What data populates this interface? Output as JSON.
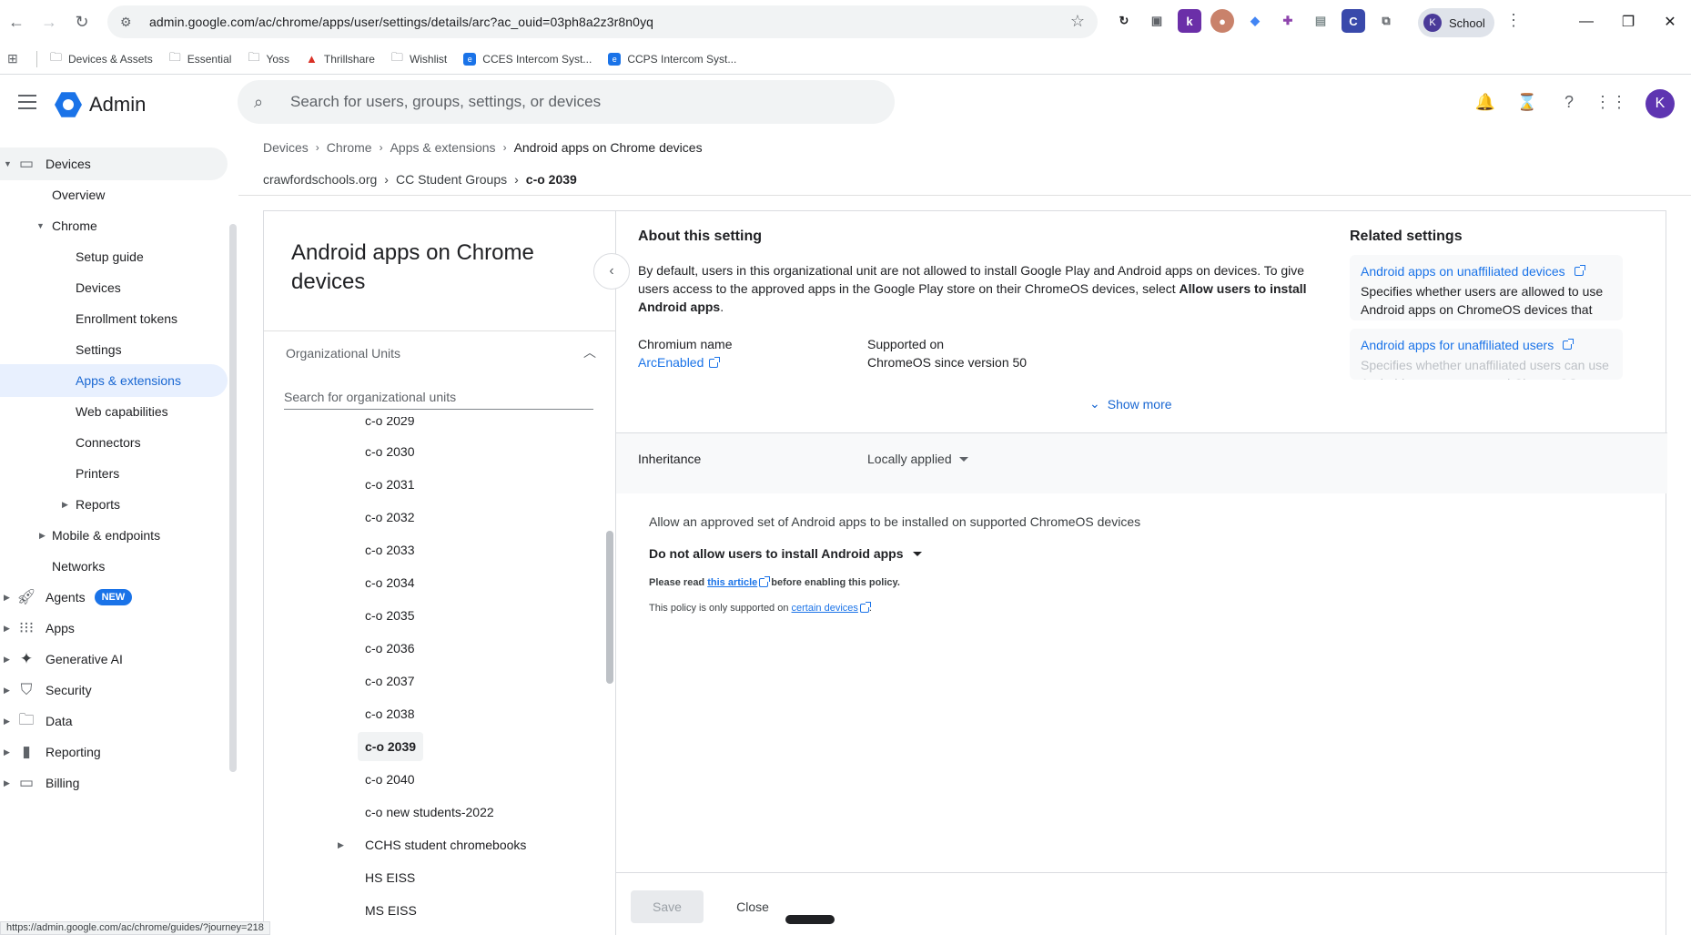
{
  "browser": {
    "url": "admin.google.com/ac/chrome/apps/user/settings/details/arc?ac_ouid=03ph8a2z3r8n0yq",
    "profile_initial": "K",
    "profile_label": "School",
    "bookmarks": [
      "Devices & Assets",
      "Essential",
      "Yoss",
      "Thrillshare",
      "Wishlist",
      "CCES Intercom Syst...",
      "CCPS Intercom Syst..."
    ],
    "status_url": "https://admin.google.com/ac/chrome/guides/?journey=218"
  },
  "header": {
    "product": "Admin",
    "search_placeholder": "Search for users, groups, settings, or devices",
    "avatar_initial": "K"
  },
  "nav": {
    "devices": "Devices",
    "overview": "Overview",
    "chrome": "Chrome",
    "setup_guide": "Setup guide",
    "chrome_devices": "Devices",
    "enrollment_tokens": "Enrollment tokens",
    "settings": "Settings",
    "apps_extensions": "Apps & extensions",
    "web_capabilities": "Web capabilities",
    "connectors": "Connectors",
    "printers": "Printers",
    "reports": "Reports",
    "mobile_endpoints": "Mobile & endpoints",
    "networks": "Networks",
    "agents": "Agents",
    "agents_badge": "NEW",
    "apps": "Apps",
    "generative_ai": "Generative AI",
    "security": "Security",
    "data": "Data",
    "reporting": "Reporting",
    "billing": "Billing"
  },
  "breadcrumb": {
    "items": [
      "Devices",
      "Chrome",
      "Apps & extensions",
      "Android apps on Chrome devices"
    ],
    "org": [
      "crawfordschools.org",
      "CC Student Groups",
      "c-o 2039"
    ]
  },
  "ou_panel": {
    "title": "Android apps on Chrome devices",
    "section": "Organizational Units",
    "search_placeholder": "Search for organizational units",
    "units": [
      "c-o 2029",
      "c-o 2030",
      "c-o 2031",
      "c-o 2032",
      "c-o 2033",
      "c-o 2034",
      "c-o 2035",
      "c-o 2036",
      "c-o 2037",
      "c-o 2038",
      "c-o 2039",
      "c-o 2040",
      "c-o new students-2022",
      "CCHS student chromebooks",
      "HS EISS",
      "MS EISS"
    ],
    "selected": "c-o 2039"
  },
  "about": {
    "heading": "About this setting",
    "text_before": "By default, users in this organizational unit are not allowed to install Google Play and Android apps on devices. To give users access to the approved apps in the Google Play store on their ChromeOS devices, select ",
    "text_bold": "Allow users to install Android apps",
    "text_after": ".",
    "chromium_name_label": "Chromium name",
    "chromium_name_value": "ArcEnabled",
    "supported_label": "Supported on",
    "supported_value": "ChromeOS since version 50",
    "show_more": "Show more"
  },
  "related": {
    "heading": "Related settings",
    "items": [
      {
        "title": "Android apps on unaffiliated devices",
        "desc": "Specifies whether users are allowed to use Android apps on ChromeOS devices that ar..."
      },
      {
        "title": "Android apps for unaffiliated users",
        "desc": "Specifies whether unaffiliated users can use Android apps on managed ChromeOS..."
      }
    ]
  },
  "inheritance": {
    "label": "Inheritance",
    "value": "Locally applied"
  },
  "policy": {
    "description": "Allow an approved set of Android apps to be installed on supported ChromeOS devices",
    "selected_option": "Do not allow users to install Android apps",
    "note1_before": "Please read ",
    "note1_link": "this article",
    "note1_after": " before enabling this policy.",
    "note2_before": "This policy is only supported on ",
    "note2_link": "certain devices",
    "note2_after": "."
  },
  "footer": {
    "save": "Save",
    "close": "Close"
  }
}
